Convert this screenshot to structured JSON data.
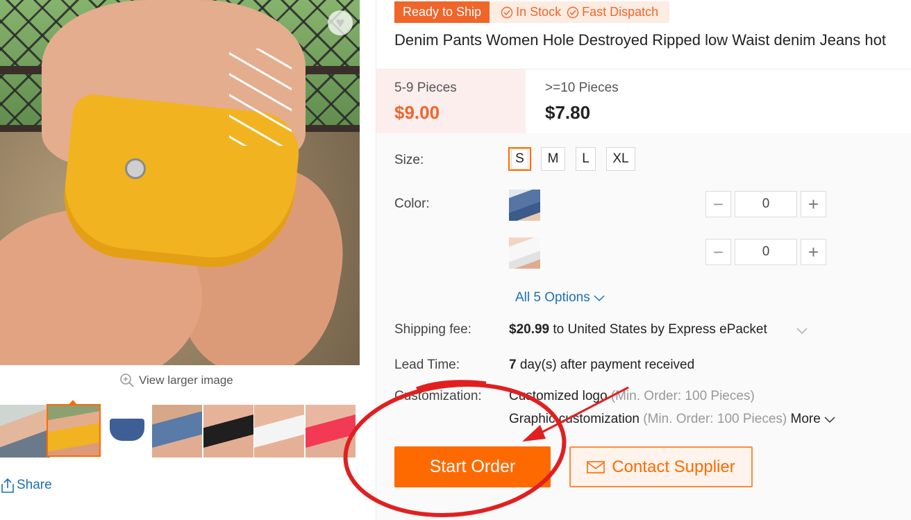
{
  "gallery": {
    "view_larger": "View larger image",
    "share": "Share",
    "thumbnail_count": 7,
    "active_thumbnail": 2
  },
  "badges": {
    "ready_to_ship": "Ready to Ship",
    "in_stock": "In Stock",
    "fast_dispatch": "Fast Dispatch"
  },
  "product": {
    "title": "Denim Pants Women Hole Destroyed Ripped low Waist denim Jeans hot"
  },
  "pricing": {
    "tiers": [
      {
        "range": "5-9 Pieces",
        "price": "$9.00"
      },
      {
        "range": ">=10 Pieces",
        "price": "$7.80"
      }
    ]
  },
  "options": {
    "size_label": "Size:",
    "sizes": [
      "S",
      "M",
      "L",
      "XL"
    ],
    "selected_size": "S",
    "color_label": "Color:",
    "colors": [
      {
        "quantity": "0"
      },
      {
        "quantity": "0"
      }
    ],
    "minus": "−",
    "plus": "+",
    "all_options": "All 5 Options"
  },
  "shipping": {
    "label": "Shipping fee:",
    "amount": "$20.99",
    "rest": " to United States by Express ePacket"
  },
  "lead_time": {
    "label": "Lead Time:",
    "days": "7",
    "rest": " day(s) after payment received"
  },
  "customization": {
    "label": "Customization:",
    "line1_text": "Customized logo",
    "line1_min": " (Min. Order: 100 Pieces)",
    "line2_text": "Graphic customization",
    "line2_min": " (Min. Order: 100 Pieces)",
    "more": "More"
  },
  "actions": {
    "start_order": "Start Order",
    "contact_supplier": "Contact Supplier"
  },
  "colors": {
    "accent": "#ff6a00",
    "link": "#1a6fb8",
    "annotation": "#e02020"
  },
  "icons": [
    "heart-icon",
    "zoom-icon",
    "share-icon",
    "check-circle-icon",
    "chevron-down-icon",
    "mail-icon"
  ]
}
